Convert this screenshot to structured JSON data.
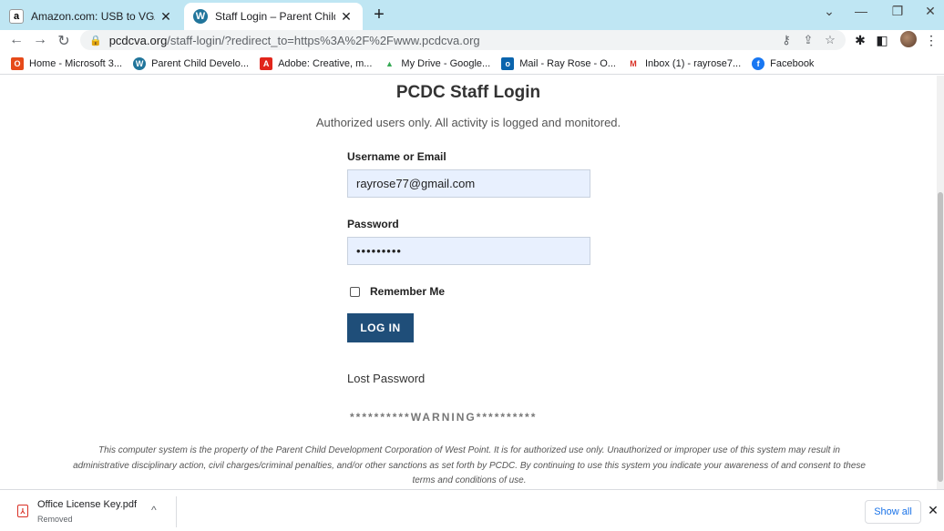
{
  "browser": {
    "tabs": [
      {
        "title": "Amazon.com: USB to VGA Adapt",
        "favicon": "amazon-favicon",
        "fav_glyph": "a"
      },
      {
        "title": "Staff Login – Parent Child Develo",
        "favicon": "wordpress-favicon",
        "fav_glyph": "W"
      }
    ],
    "new_tab_glyph": "+",
    "tab_close_glyph": "✕",
    "address": {
      "domain": "pcdcva.org",
      "path": "/staff-login/?redirect_to=https%3A%2F%2Fwww.pcdcva.org"
    },
    "bookmarks": [
      {
        "label": "Home - Microsoft 3...",
        "icon": "office-icon",
        "color": "#e64a19",
        "glyph": "O"
      },
      {
        "label": "Parent Child Develo...",
        "icon": "wordpress-icon",
        "color": "#21759b",
        "glyph": "W"
      },
      {
        "label": "Adobe: Creative, m...",
        "icon": "adobe-icon",
        "color": "#e1251b",
        "glyph": "A"
      },
      {
        "label": "My Drive - Google...",
        "icon": "google-drive-icon",
        "color": "#34a853",
        "glyph": "▲"
      },
      {
        "label": "Mail - Ray Rose - O...",
        "icon": "outlook-icon",
        "color": "#0a64ad",
        "glyph": "o"
      },
      {
        "label": "Inbox (1) - rayrose7...",
        "icon": "gmail-icon",
        "color": "#d93025",
        "glyph": "M"
      },
      {
        "label": "Facebook",
        "icon": "facebook-icon",
        "color": "#1877f2",
        "glyph": "f"
      }
    ]
  },
  "login": {
    "heading": "PCDC Staff Login",
    "subtitle": "Authorized users only. All activity is logged and monitored.",
    "username_label": "Username or Email",
    "username_value": "rayrose77@gmail.com",
    "password_label": "Password",
    "password_value": "•••••••••",
    "remember_label": "Remember Me",
    "login_button": "LOG IN",
    "lost_password": "Lost Password",
    "warning": "**********WARNING**********",
    "disclaimer": "This computer system is the property of the Parent Child Development Corporation of West Point. It is for authorized use only.  Unauthorized or improper use of this system may result in administrative disciplinary action, civil charges/criminal penalties, and/or other sanctions as set forth by PCDC. By continuing to use this system you indicate your awareness of and consent to these terms and conditions of use."
  },
  "downloads": {
    "file_name": "Office License Key.pdf",
    "status": "Removed",
    "show_all": "Show all"
  }
}
